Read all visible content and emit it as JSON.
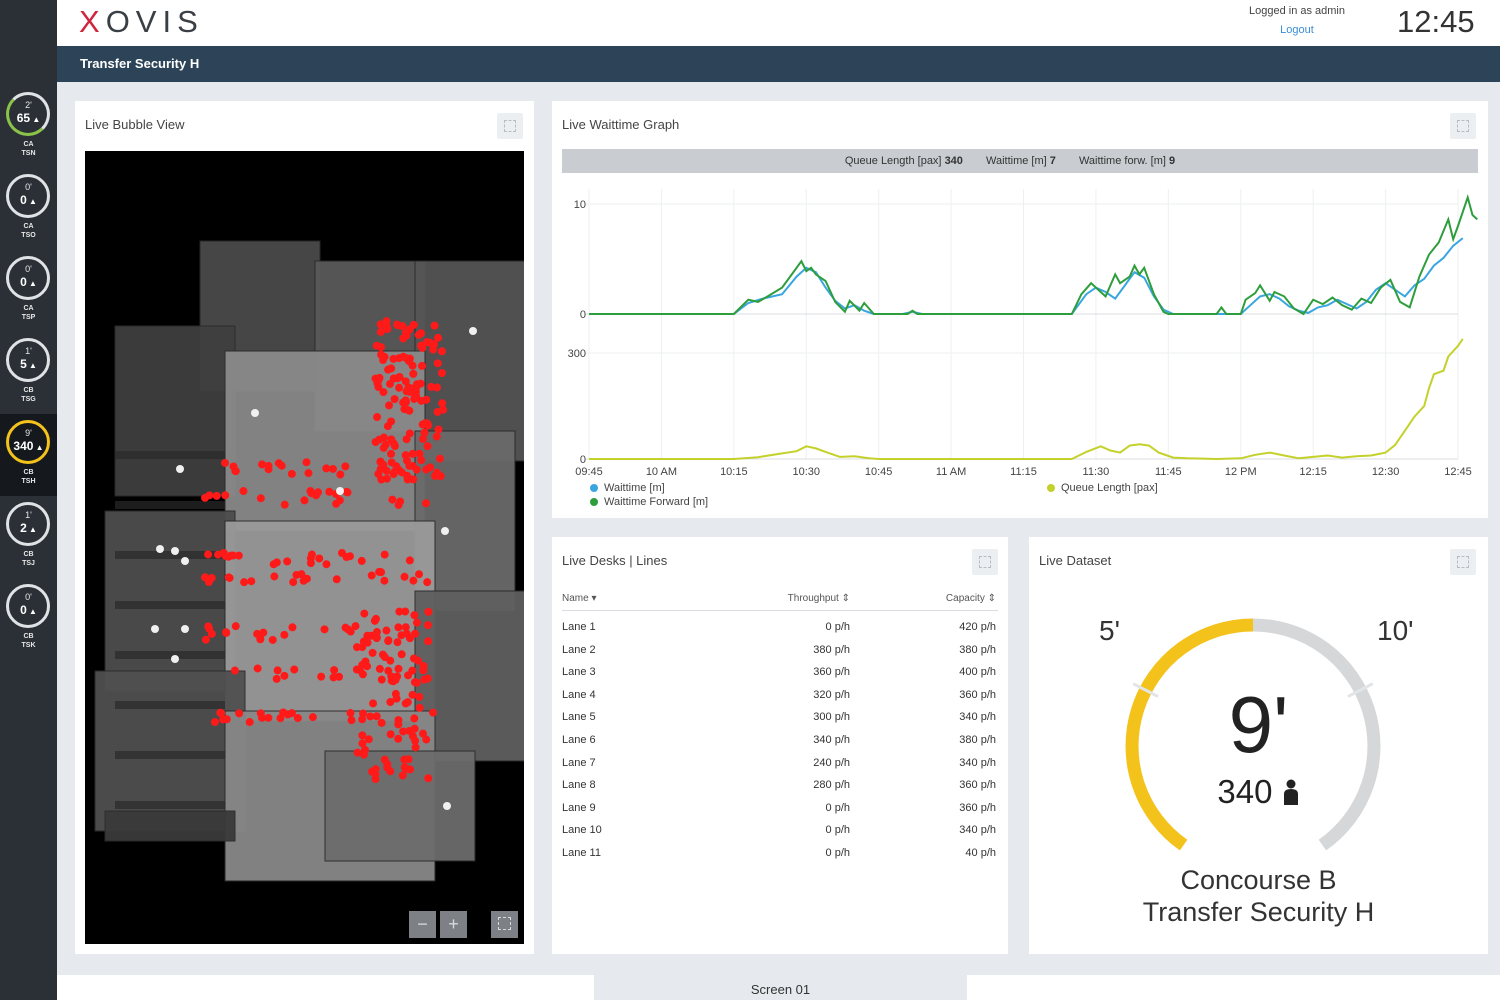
{
  "header": {
    "logo_x": "X",
    "logo_rest": "OVIS",
    "logged_in": "Logged in as admin",
    "logout": "Logout",
    "clock": "12:45"
  },
  "subbar": {
    "title": "Transfer Security H"
  },
  "sidebar": {
    "items": [
      {
        "minutes": "2'",
        "value": "65",
        "code1": "CA",
        "code2": "TSN"
      },
      {
        "minutes": "0'",
        "value": "0",
        "code1": "CA",
        "code2": "TSO"
      },
      {
        "minutes": "0'",
        "value": "0",
        "code1": "CA",
        "code2": "TSP"
      },
      {
        "minutes": "1'",
        "value": "5",
        "code1": "CB",
        "code2": "TSG"
      },
      {
        "minutes": "9'",
        "value": "340",
        "code1": "CB",
        "code2": "TSH"
      },
      {
        "minutes": "1'",
        "value": "2",
        "code1": "CB",
        "code2": "TSJ"
      },
      {
        "minutes": "0'",
        "value": "0",
        "code1": "CB",
        "code2": "TSK"
      }
    ]
  },
  "bubble": {
    "title": "Live Bubble View",
    "minus": "−",
    "plus": "+"
  },
  "graph": {
    "title": "Live Waittime Graph",
    "bar_ql_label": "Queue Length [pax]",
    "bar_ql_value": "340",
    "bar_wt_label": "Waittime [m]",
    "bar_wt_value": "7",
    "bar_wtf_label": "Waittime forw. [m]",
    "bar_wtf_value": "9",
    "legend_waittime": "Waittime [m]",
    "legend_waittime_forward": "Waittime Forward [m]",
    "legend_queue": "Queue Length [pax]"
  },
  "chart_data": {
    "type": "line",
    "x_ticks": [
      "09:45",
      "10 AM",
      "10:15",
      "10:30",
      "10:45",
      "11 AM",
      "11:15",
      "11:30",
      "11:45",
      "12 PM",
      "12:15",
      "12:30",
      "12:45"
    ],
    "x_minutes": [
      0,
      15,
      30,
      45,
      60,
      75,
      90,
      105,
      120,
      135,
      150,
      165,
      180
    ],
    "top_y_ticks": [
      "10",
      "0"
    ],
    "top_ylim": [
      0,
      10
    ],
    "bottom_y_ticks": [
      "300",
      "0"
    ],
    "bottom_ylim": [
      0,
      300
    ],
    "colors": {
      "waittime": "#3aa6e0",
      "waittime_forward": "#2e9e3c",
      "queue": "#c3d12a"
    },
    "waittime": [
      [
        0,
        0
      ],
      [
        30,
        0
      ],
      [
        33,
        1
      ],
      [
        36,
        1.4
      ],
      [
        40,
        1.8
      ],
      [
        43,
        3.4
      ],
      [
        45,
        4.2
      ],
      [
        47,
        3.8
      ],
      [
        49,
        2.4
      ],
      [
        51,
        1.2
      ],
      [
        53,
        0.5
      ],
      [
        55,
        0.8
      ],
      [
        57,
        0.3
      ],
      [
        59,
        0
      ],
      [
        65,
        0
      ],
      [
        67,
        0.2
      ],
      [
        69,
        0
      ],
      [
        100,
        0
      ],
      [
        103,
        1.8
      ],
      [
        105,
        2.4
      ],
      [
        107,
        2
      ],
      [
        109,
        1.4
      ],
      [
        111,
        2.6
      ],
      [
        113,
        3.8
      ],
      [
        115,
        3.3
      ],
      [
        117,
        1.6
      ],
      [
        119,
        0.4
      ],
      [
        121,
        0
      ],
      [
        130,
        0
      ],
      [
        135,
        0
      ],
      [
        137,
        0.8
      ],
      [
        139,
        1.6
      ],
      [
        141,
        1.8
      ],
      [
        143,
        1.4
      ],
      [
        145,
        0.7
      ],
      [
        147,
        0.3
      ],
      [
        149,
        0.1
      ],
      [
        151,
        0.6
      ],
      [
        153,
        0.8
      ],
      [
        155,
        1.3
      ],
      [
        157,
        0.9
      ],
      [
        159,
        0.5
      ],
      [
        161,
        1.1
      ],
      [
        163,
        2.2
      ],
      [
        165,
        2.8
      ],
      [
        167,
        2.2
      ],
      [
        169,
        1.6
      ],
      [
        171,
        2.6
      ],
      [
        173,
        3.2
      ],
      [
        175,
        4.4
      ],
      [
        177,
        5.1
      ],
      [
        179,
        6.2
      ],
      [
        181,
        6.9
      ]
    ],
    "waittime_forward": [
      [
        0,
        0
      ],
      [
        30,
        0
      ],
      [
        33,
        1.3
      ],
      [
        35,
        1.1
      ],
      [
        37,
        1.6
      ],
      [
        40,
        2.4
      ],
      [
        42,
        3.6
      ],
      [
        44,
        4.8
      ],
      [
        45,
        3.9
      ],
      [
        46,
        4.2
      ],
      [
        47,
        3.6
      ],
      [
        49,
        3.0
      ],
      [
        51,
        1.1
      ],
      [
        53,
        0.2
      ],
      [
        54,
        1.2
      ],
      [
        56,
        0.3
      ],
      [
        57,
        1.0
      ],
      [
        59,
        0
      ],
      [
        66,
        0
      ],
      [
        67,
        0.3
      ],
      [
        68,
        0
      ],
      [
        100,
        0
      ],
      [
        102,
        1.8
      ],
      [
        104,
        2.8
      ],
      [
        106,
        2.0
      ],
      [
        107,
        1.6
      ],
      [
        109,
        3.6
      ],
      [
        110,
        2.8
      ],
      [
        112,
        3.4
      ],
      [
        113,
        4.4
      ],
      [
        114,
        3.6
      ],
      [
        115,
        4.2
      ],
      [
        117,
        1.8
      ],
      [
        119,
        0.2
      ],
      [
        120,
        0
      ],
      [
        130,
        0
      ],
      [
        131,
        0.6
      ],
      [
        132,
        0
      ],
      [
        135,
        0
      ],
      [
        136,
        1.3
      ],
      [
        138,
        1.9
      ],
      [
        139,
        2.6
      ],
      [
        141,
        1.2
      ],
      [
        142,
        2.0
      ],
      [
        144,
        1.6
      ],
      [
        146,
        0.5
      ],
      [
        148,
        0
      ],
      [
        150,
        1.3
      ],
      [
        152,
        0.9
      ],
      [
        154,
        1.5
      ],
      [
        156,
        0.8
      ],
      [
        158,
        0.4
      ],
      [
        160,
        1.4
      ],
      [
        162,
        1.0
      ],
      [
        164,
        2.4
      ],
      [
        166,
        3.1
      ],
      [
        168,
        1.1
      ],
      [
        170,
        0.6
      ],
      [
        172,
        3.4
      ],
      [
        174,
        5.4
      ],
      [
        176,
        6.5
      ],
      [
        178,
        8.6
      ],
      [
        179,
        6.8
      ],
      [
        180,
        8.0
      ],
      [
        182,
        10.6
      ],
      [
        183,
        9.0
      ],
      [
        184,
        8.6
      ]
    ],
    "queue": [
      [
        0,
        0
      ],
      [
        30,
        0
      ],
      [
        35,
        5
      ],
      [
        39,
        14
      ],
      [
        43,
        22
      ],
      [
        45,
        36
      ],
      [
        47,
        30
      ],
      [
        49,
        20
      ],
      [
        52,
        6
      ],
      [
        55,
        8
      ],
      [
        58,
        2
      ],
      [
        60,
        0
      ],
      [
        100,
        0
      ],
      [
        103,
        20
      ],
      [
        106,
        36
      ],
      [
        108,
        24
      ],
      [
        110,
        18
      ],
      [
        112,
        38
      ],
      [
        114,
        42
      ],
      [
        116,
        38
      ],
      [
        118,
        18
      ],
      [
        121,
        4
      ],
      [
        124,
        2
      ],
      [
        130,
        0
      ],
      [
        135,
        2
      ],
      [
        138,
        12
      ],
      [
        141,
        18
      ],
      [
        144,
        10
      ],
      [
        147,
        2
      ],
      [
        150,
        6
      ],
      [
        153,
        10
      ],
      [
        156,
        4
      ],
      [
        159,
        8
      ],
      [
        162,
        10
      ],
      [
        165,
        18
      ],
      [
        167,
        40
      ],
      [
        169,
        80
      ],
      [
        171,
        120
      ],
      [
        173,
        150
      ],
      [
        174,
        200
      ],
      [
        175,
        240
      ],
      [
        177,
        250
      ],
      [
        178,
        290
      ],
      [
        180,
        320
      ],
      [
        181,
        340
      ]
    ]
  },
  "desks": {
    "title": "Live Desks | Lines",
    "col_name": "Name",
    "col_throughput": "Throughput",
    "col_capacity": "Capacity",
    "rows": [
      {
        "name": "Lane 1",
        "throughput": "0 p/h",
        "capacity": "420 p/h"
      },
      {
        "name": "Lane 2",
        "throughput": "380 p/h",
        "capacity": "380 p/h"
      },
      {
        "name": "Lane 3",
        "throughput": "360 p/h",
        "capacity": "400 p/h"
      },
      {
        "name": "Lane 4",
        "throughput": "320 p/h",
        "capacity": "360 p/h"
      },
      {
        "name": "Lane 5",
        "throughput": "300 p/h",
        "capacity": "340 p/h"
      },
      {
        "name": "Lane 6",
        "throughput": "340 p/h",
        "capacity": "380 p/h"
      },
      {
        "name": "Lane 7",
        "throughput": "240 p/h",
        "capacity": "340 p/h"
      },
      {
        "name": "Lane 8",
        "throughput": "280 p/h",
        "capacity": "360 p/h"
      },
      {
        "name": "Lane 9",
        "throughput": "0 p/h",
        "capacity": "360 p/h"
      },
      {
        "name": "Lane 10",
        "throughput": "0 p/h",
        "capacity": "340 p/h"
      },
      {
        "name": "Lane 11",
        "throughput": "0 p/h",
        "capacity": "40 p/h"
      }
    ]
  },
  "dataset": {
    "title": "Live Dataset",
    "low_mark": "5'",
    "high_mark": "10'",
    "waittime": "9'",
    "count": "340",
    "waittime_fraction": 0.5,
    "location_line1": "Concourse B",
    "location_line2": "Transfer Security H",
    "gauge_color": "#f3c21b",
    "track_color": "#d5d7d9"
  },
  "footer": {
    "tab": "Screen 01"
  }
}
